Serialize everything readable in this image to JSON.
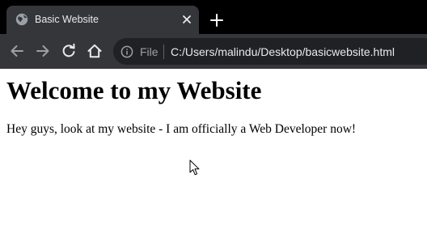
{
  "browser": {
    "tab": {
      "title": "Basic Website",
      "favicon": "globe-icon",
      "close": "close-icon"
    },
    "new_tab": "plus-icon",
    "toolbar": {
      "back": "arrow-left-icon",
      "forward": "arrow-right-icon",
      "reload": "reload-icon",
      "home": "home-icon"
    },
    "omnibox": {
      "info": "info-icon",
      "scheme": "File",
      "url": "C:/Users/malindu/Desktop/basicwebsite.html"
    }
  },
  "page": {
    "heading": "Welcome to my Website",
    "text": "Hey guys, look at my website - I am officially a Web Developer now!"
  },
  "colors": {
    "tabstrip_bg": "#000000",
    "tab_bg": "#35363a",
    "toolbar_bg": "#35363a",
    "omnibox_bg": "#202124",
    "page_bg": "#ffffff"
  }
}
